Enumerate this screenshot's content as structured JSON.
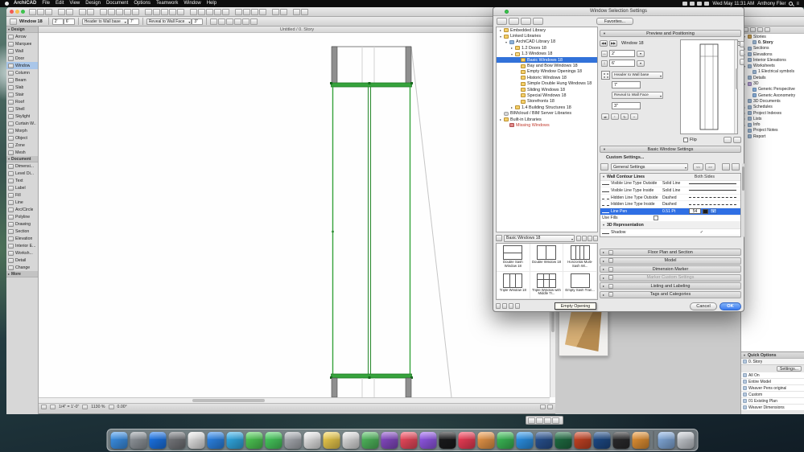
{
  "palette": {
    "accent_blue": "#2f6fe4",
    "selection_blue": "#3272d9",
    "window_green": "#36a33c",
    "wall_gray": "#8f8f8f",
    "ok_blue": "#3b7bf0"
  },
  "menubar": {
    "items": [
      "ArchiCAD",
      "File",
      "Edit",
      "View",
      "Design",
      "Document",
      "Options",
      "Teamwork",
      "Window",
      "Help"
    ],
    "status_icons": [
      "volume",
      "bluetooth",
      "wifi",
      "battery"
    ],
    "clock": "Wed May 11:31 AM",
    "user": "Anthony Flier"
  },
  "toolbars": {
    "row1_groups": [
      [
        "new-file",
        "open-file",
        "save"
      ],
      [
        "print",
        "publish"
      ],
      [
        "undo",
        "redo"
      ],
      [
        "pan",
        "zoom-in",
        "zoom-out",
        "fit-in-window",
        "previous-view"
      ],
      [
        "layers",
        "story-up",
        "story-down",
        "grid-snap",
        "gravity"
      ],
      [
        "trim",
        "split",
        "adjust",
        "intersect",
        "fillet"
      ],
      [
        "group",
        "ungroup",
        "lock",
        "unlock"
      ],
      [
        "show-3d",
        "section-3d"
      ],
      [
        "find-select",
        "element-information"
      ]
    ],
    "row2_label": "Window 18",
    "row2_fields": {
      "width": "2'",
      "height": "6'",
      "anchor1": "Header to Wall base",
      "anchor1_value": "7'",
      "anchor2": "Reveal to Wall Face",
      "anchor2_value": "3\""
    },
    "row2_extra_icons": [
      "pen-color",
      "fill-type",
      "layer",
      "model-view",
      "settings",
      "favorites"
    ]
  },
  "toolbox": {
    "sections": [
      {
        "title": "Design",
        "tools": [
          "Arrow",
          "Marquee",
          "Wall",
          "Door",
          "Window",
          "Column",
          "Beam",
          "Slab",
          "Stair",
          "Roof",
          "Shell",
          "Skylight",
          "Curtain W...",
          "Morph",
          "Object",
          "Zone",
          "Mesh"
        ]
      },
      {
        "title": "Document",
        "tools": [
          "Dimensi...",
          "Level Di...",
          "Text",
          "Label",
          "Fill",
          "Line",
          "Arc/Circle",
          "Polyline",
          "Drawing",
          "Section",
          "Elevation",
          "Interior E...",
          "Worksh...",
          "Detail",
          "Change"
        ]
      }
    ],
    "active_tool": "Window",
    "more_label": "More"
  },
  "canvas": {
    "caption": "Untitled / 0. Story"
  },
  "statusbar": {
    "scale": "1/4\" = 1'-0\"",
    "zoom": "1130 %",
    "rotation": "0.00°"
  },
  "dialog": {
    "title": "Window Selection Settings",
    "toolbar_icons": [
      "list-view",
      "new-folder",
      "home",
      "search"
    ],
    "favorites_label": "Favorites...",
    "tree": [
      {
        "label": "Embedded Library",
        "indent": 0,
        "icon": "folder",
        "expander": "closed"
      },
      {
        "label": "Linked Libraries",
        "indent": 0,
        "icon": "folder",
        "expander": "open"
      },
      {
        "label": "ArchiCAD Library 18",
        "indent": 1,
        "icon": "library",
        "expander": "open"
      },
      {
        "label": "1.2 Doors 18",
        "indent": 2,
        "icon": "folder",
        "expander": "closed"
      },
      {
        "label": "1.3 Windows 18",
        "indent": 2,
        "icon": "folder-open",
        "expander": "open"
      },
      {
        "label": "Basic Windows 18",
        "indent": 3,
        "icon": "folder",
        "selected": true
      },
      {
        "label": "Bay and Bow Windows 18",
        "indent": 3,
        "icon": "folder"
      },
      {
        "label": "Empty Window Openings 18",
        "indent": 3,
        "icon": "folder"
      },
      {
        "label": "Historic Windows 18",
        "indent": 3,
        "icon": "folder"
      },
      {
        "label": "Simple Double Hung Windows 18",
        "indent": 3,
        "icon": "folder"
      },
      {
        "label": "Sliding Windows 18",
        "indent": 3,
        "icon": "folder"
      },
      {
        "label": "Special Windows 18",
        "indent": 3,
        "icon": "folder"
      },
      {
        "label": "Storefronts 18",
        "indent": 3,
        "icon": "folder"
      },
      {
        "label": "1.4 Building Structures 18",
        "indent": 2,
        "icon": "folder",
        "expander": "closed"
      },
      {
        "label": "BIMcloud / BIM Server Libraries",
        "indent": 0,
        "icon": "cloud"
      },
      {
        "label": "Built-in Libraries",
        "indent": 0,
        "icon": "folder",
        "expander": "closed"
      },
      {
        "label": "Missing Windows",
        "indent": 1,
        "icon": "missing",
        "missing": true
      }
    ],
    "folder_dropdown": "Basic Windows 18",
    "view_icons": [
      "large-icons-view",
      "small-icons-view",
      "list-view",
      "preview-view"
    ],
    "thumbnails": [
      {
        "caption": "Double Sash Window 18",
        "glyph": "sash2"
      },
      {
        "caption": "Double Window 18",
        "glyph": "double"
      },
      {
        "caption": "Horizontal Multi-Sash Wi...",
        "glyph": "multi"
      },
      {
        "caption": "Triple Window 18",
        "glyph": "triple"
      },
      {
        "caption": "Triple Window with Middle Tr...",
        "glyph": "triplemid"
      },
      {
        "caption": "Empty Sash Tran...",
        "glyph": "empty"
      }
    ],
    "bottom_icons": [
      "add-part",
      "open-part",
      "reload",
      "part-info"
    ],
    "tooltip": "Empty Opening",
    "preview": {
      "section_title": "Preview and Positioning",
      "prev_label": "◀◀",
      "next_label": "▶▶",
      "object_name": "Window 18",
      "width_value": "2'",
      "height_value": "6'",
      "anchor_header_label": "Header to Wall base",
      "anchor_header_value": "7'",
      "anchor_reveal_label": "Reveal to Wall Face",
      "anchor_reveal_value": "3\"",
      "flip_label": "Flip"
    },
    "basic_settings_title": "Basic Window Settings",
    "custom_settings_label": "Custom Settings...",
    "general_settings_label": "General Settings",
    "nav_prev": "<<",
    "nav_next": ">>",
    "table": {
      "group1": "Wall Contour Lines",
      "group1_col": "Both Sides",
      "rows": [
        {
          "label": "Visible Line Type Outside",
          "value": "Solid Line",
          "preview": "solid"
        },
        {
          "label": "Visible Line Type Inside",
          "value": "Solid Line",
          "preview": "solid"
        },
        {
          "label": "Hidden Line Type Outside",
          "value": "Dashed",
          "preview": "dashed"
        },
        {
          "label": "Hidden Line Type Inside",
          "value": "Dashed",
          "preview": "dashed"
        },
        {
          "label": "Line Pen",
          "value": "0.51 Pt",
          "pen_number": "54",
          "selected": true
        },
        {
          "label": "Use Fills",
          "checkbox": false
        }
      ],
      "group2": "3D Representation",
      "rows2": [
        {
          "label": "Shadow",
          "checkbox": true
        }
      ]
    },
    "collapsed_sections": [
      "Floor Plan and Section",
      "Model",
      "Dimension Marker",
      "Marker Custom Settings",
      "Listing and Labeling",
      "Tags and Categories"
    ],
    "disabled_section": "Marker Custom Settings",
    "cancel_label": "Cancel",
    "ok_label": "OK"
  },
  "navigator": {
    "header_icons": [
      "project-map",
      "view-map",
      "layout-book",
      "publisher"
    ],
    "items": [
      {
        "label": "Stories",
        "indent": 0,
        "icon": "book",
        "expander": "open"
      },
      {
        "label": "0. Story",
        "indent": 1,
        "icon": "story",
        "selected": true
      },
      {
        "label": "Sections",
        "indent": 0,
        "icon": "view",
        "expander": "closed"
      },
      {
        "label": "Elevations",
        "indent": 0,
        "icon": "view",
        "expander": "closed"
      },
      {
        "label": "Interior Elevations",
        "indent": 0,
        "icon": "view"
      },
      {
        "label": "Worksheets",
        "indent": 0,
        "icon": "view",
        "expander": "open"
      },
      {
        "label": "1 Electrical symbols",
        "indent": 1,
        "icon": "sheet"
      },
      {
        "label": "Details",
        "indent": 0,
        "icon": "view"
      },
      {
        "label": "3D",
        "indent": 0,
        "icon": "cube",
        "expander": "open"
      },
      {
        "label": "Generic Perspective",
        "indent": 1,
        "icon": "camera"
      },
      {
        "label": "Generic Axonometry",
        "indent": 1,
        "icon": "camera"
      },
      {
        "label": "3D Documents",
        "indent": 0,
        "icon": "view"
      },
      {
        "label": "Schedules",
        "indent": 0,
        "icon": "view",
        "expander": "closed"
      },
      {
        "label": "Project Indexes",
        "indent": 0,
        "icon": "view",
        "expander": "closed"
      },
      {
        "label": "Lists",
        "indent": 0,
        "icon": "view",
        "expander": "closed"
      },
      {
        "label": "Info",
        "indent": 0,
        "icon": "view",
        "expander": "closed"
      },
      {
        "label": "Project Notes",
        "indent": 0,
        "icon": "sheet"
      },
      {
        "label": "Report",
        "indent": 0,
        "icon": "sheet"
      }
    ]
  },
  "quickoptions": {
    "title": "Quick Options",
    "story_label": "0. Story",
    "settings_label": "Settings...",
    "rows": [
      "All On",
      "Entire Model",
      "Weaver Pens original",
      "Custom",
      "01 Existing Plan",
      "Weaver Dimensions"
    ]
  },
  "mini_palette_icons": [
    "guide-lines",
    "snap-points",
    "cursor-snap",
    "tracker"
  ],
  "dock": {
    "apps": [
      {
        "name": "finder",
        "color": "#3f9af5"
      },
      {
        "name": "launchpad",
        "color": "#9aa0a6"
      },
      {
        "name": "app-store",
        "color": "#1d7bf5"
      },
      {
        "name": "system-preferences",
        "color": "#7d7f83"
      },
      {
        "name": "photos",
        "color": "#f2f2f2"
      },
      {
        "name": "mail",
        "color": "#2f8df6"
      },
      {
        "name": "safari",
        "color": "#35b5f3"
      },
      {
        "name": "messages",
        "color": "#54d75a"
      },
      {
        "name": "facetime",
        "color": "#4cd964"
      },
      {
        "name": "contacts",
        "color": "#b5b9bf"
      },
      {
        "name": "calendar",
        "color": "#f5f5f5"
      },
      {
        "name": "notes",
        "color": "#fbd851"
      },
      {
        "name": "reminders",
        "color": "#ececec"
      },
      {
        "name": "maps",
        "color": "#55c463"
      },
      {
        "name": "photo-booth",
        "color": "#8e4fd0"
      },
      {
        "name": "music",
        "color": "#fc4f63"
      },
      {
        "name": "podcasts",
        "color": "#9b5df5"
      },
      {
        "name": "tv",
        "color": "#1c1c1e"
      },
      {
        "name": "news",
        "color": "#fd415b"
      },
      {
        "name": "pages",
        "color": "#f7a04d"
      },
      {
        "name": "numbers",
        "color": "#3fc65c"
      },
      {
        "name": "keynote",
        "color": "#2e9bf5"
      },
      {
        "name": "word",
        "color": "#2b579a"
      },
      {
        "name": "excel",
        "color": "#217346"
      },
      {
        "name": "powerpoint",
        "color": "#d24726"
      },
      {
        "name": "archicad",
        "color": "#1f4f8f"
      },
      {
        "name": "terminal",
        "color": "#2d2d2f"
      },
      {
        "name": "calculator",
        "color": "#f09a37"
      },
      {
        "name": "downloads",
        "color": "#8ab4e8"
      },
      {
        "name": "trash",
        "color": "#d1d6dc"
      }
    ]
  }
}
